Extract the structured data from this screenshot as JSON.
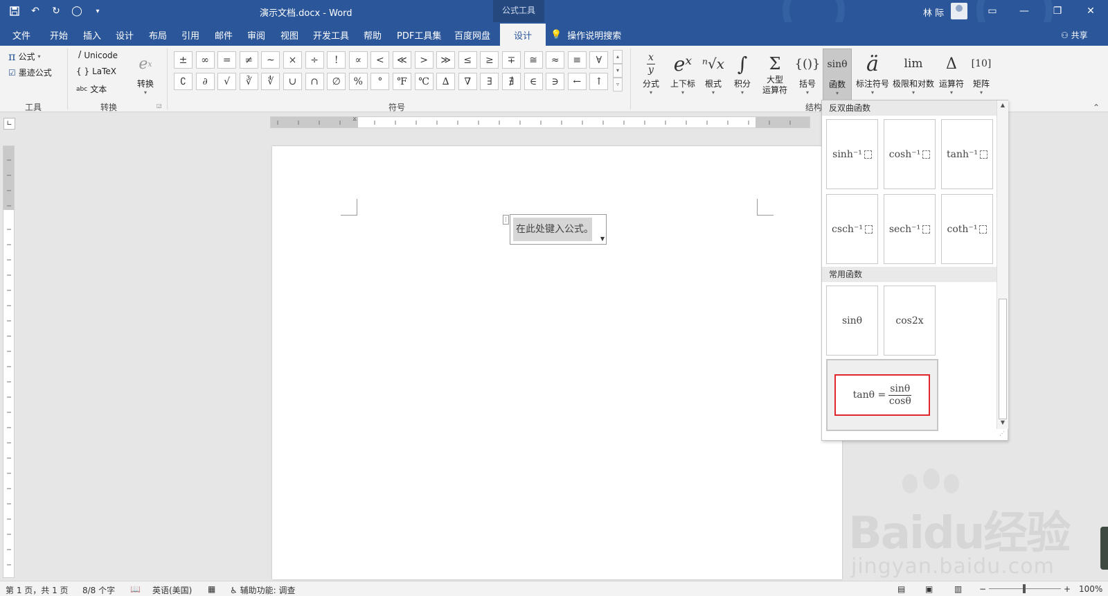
{
  "titlebar": {
    "doc_title": "演示文档.docx - Word",
    "context_tools": "公式工具",
    "user": "林 际",
    "qat": [
      "save-icon",
      "undo-icon",
      "redo-icon",
      "circle-icon",
      "customize-icon"
    ]
  },
  "tabs": [
    "文件",
    "开始",
    "插入",
    "设计",
    "布局",
    "引用",
    "邮件",
    "审阅",
    "视图",
    "开发工具",
    "帮助",
    "PDF工具集",
    "百度网盘",
    "设计"
  ],
  "tell_me": "操作说明搜索",
  "share": "共享",
  "ribbon": {
    "tools": {
      "formula": "公式",
      "ink": "墨迹公式",
      "label": "工具"
    },
    "convert": {
      "unicode": "Unicode",
      "latex": "LaTeX",
      "text": "文本",
      "convert_btn": "转换",
      "label": "转换"
    },
    "symbols": {
      "label": "符号",
      "row1": [
        "±",
        "∞",
        "=",
        "≠",
        "~",
        "×",
        "÷",
        "!",
        "∝",
        "<",
        "≪",
        ">",
        "≫",
        "≤",
        "≥",
        "∓",
        "≅",
        "≈",
        "≡",
        "∀"
      ],
      "row2": [
        "∁",
        "∂",
        "√",
        "∛",
        "∜",
        "∪",
        "∩",
        "∅",
        "%",
        "°",
        "℉",
        "℃",
        "∆",
        "∇",
        "∃",
        "∄",
        "∈",
        "∋",
        "←",
        "↑"
      ]
    },
    "structures": {
      "label": "结构",
      "buttons": [
        {
          "icon": "x/y",
          "label": "分式"
        },
        {
          "icon": "eˣ",
          "label": "上下标"
        },
        {
          "icon": "ⁿ√x",
          "label": "根式"
        },
        {
          "icon": "∫",
          "label": "积分"
        },
        {
          "icon": "Σ",
          "label": "大型\n运算符"
        },
        {
          "icon": "{()}",
          "label": "括号"
        },
        {
          "icon": "sinθ",
          "label": "函数"
        },
        {
          "icon": "ä",
          "label": "标注符号"
        },
        {
          "icon": "lim",
          "label": "极限和对数"
        },
        {
          "icon": "Δ",
          "label": "运算符"
        },
        {
          "icon": "[10]",
          "label": "矩阵"
        }
      ]
    }
  },
  "equation_placeholder": "在此处键入公式。",
  "gallery": {
    "section1": "反双曲函数",
    "inverse_hyperbolic": [
      "sinh⁻¹",
      "cosh⁻¹",
      "tanh⁻¹",
      "csch⁻¹",
      "sech⁻¹",
      "coth⁻¹"
    ],
    "section2": "常用函数",
    "common": [
      "sinθ",
      "cos2x"
    ],
    "highlight": {
      "lhs": "tanθ =",
      "num": "sinθ",
      "den": "cosθ"
    }
  },
  "status": {
    "page": "第 1 页，共 1 页",
    "words": "8/8 个字",
    "language": "英语(美国)",
    "accessibility": "辅助功能: 调查",
    "zoom": "100%"
  },
  "watermark": {
    "brand": "Baidu经验",
    "url": "jingyan.baidu.com"
  },
  "colors": {
    "word_blue": "#2b579a",
    "ribbon_bg": "#f3f3f3",
    "highlight_red": "#e0262b"
  }
}
